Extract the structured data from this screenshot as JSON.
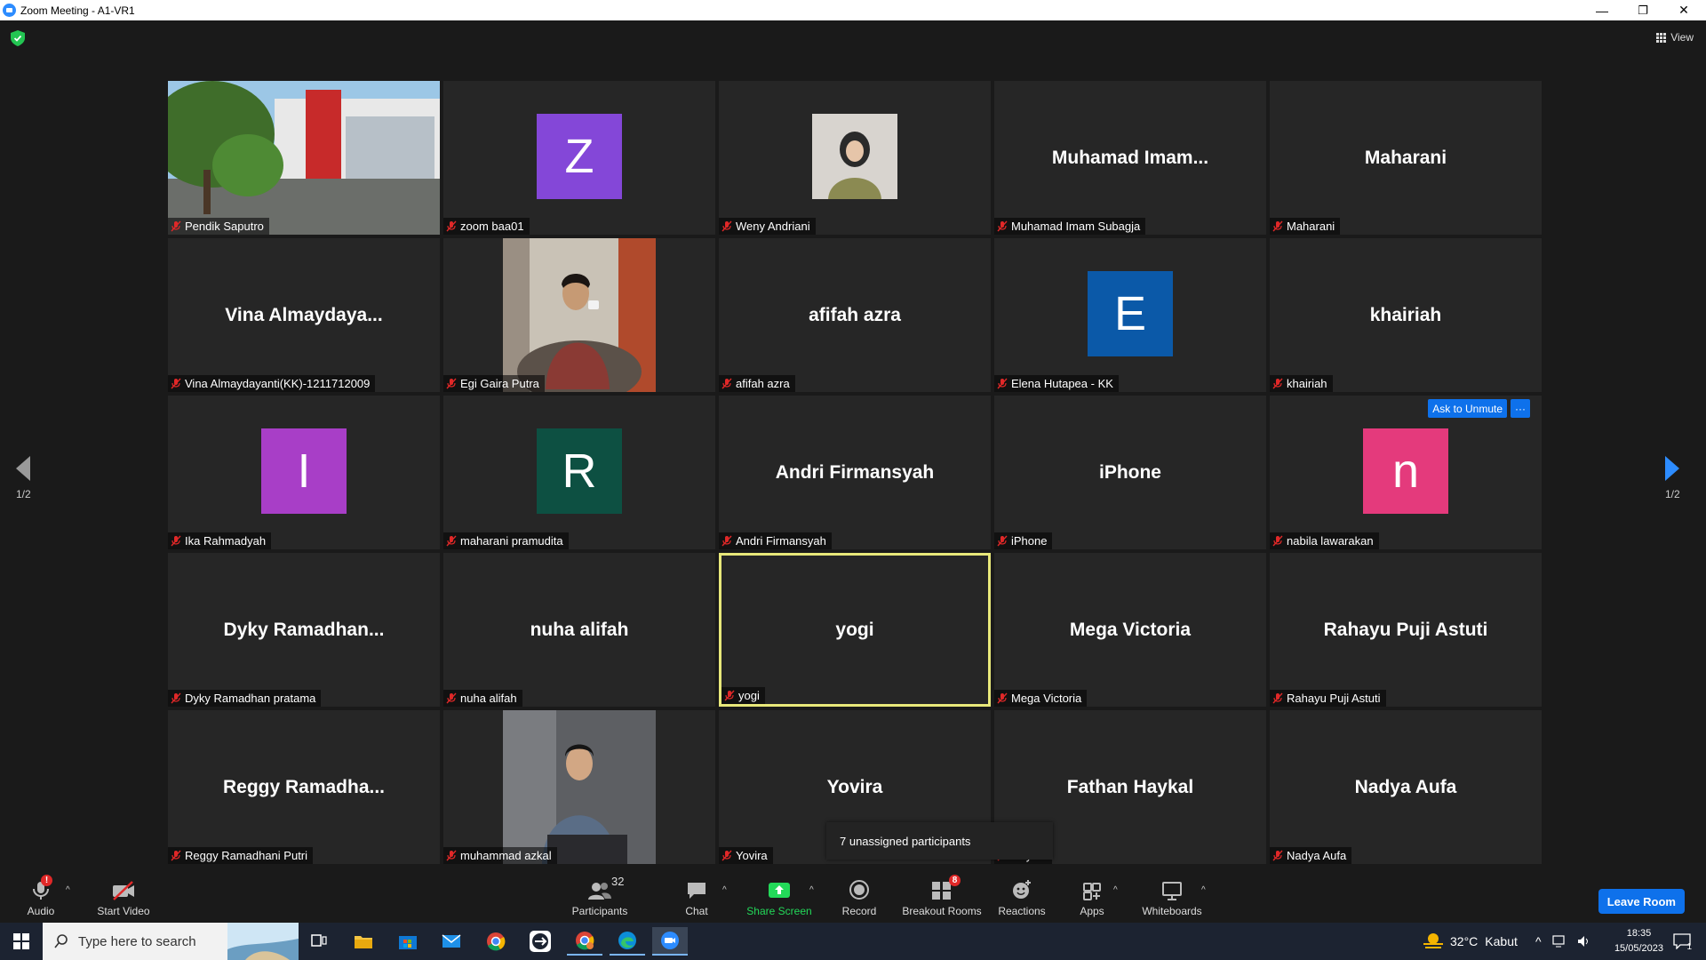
{
  "window": {
    "title": "Zoom Meeting - A1-VR1",
    "minimize": "—",
    "restore": "❐",
    "close": "✕"
  },
  "meeting": {
    "view_label": "View",
    "page_indicator_left": "1/2",
    "page_indicator_right": "1/2",
    "ask_to_unmute": "Ask to Unmute",
    "more_label": "···",
    "unassigned": "7 unassigned participants",
    "tiles": [
      {
        "bigname": "",
        "label": "Pendik Saputro",
        "kind": "photo-building"
      },
      {
        "bigname": "",
        "label": "zoom baa01",
        "kind": "avatar",
        "letter": "Z",
        "color": "#8447d8"
      },
      {
        "bigname": "",
        "label": "Weny Andriani",
        "kind": "photo-small"
      },
      {
        "bigname": "Muhamad  Imam...",
        "label": "Muhamad Imam Subagja",
        "kind": "name"
      },
      {
        "bigname": "Maharani",
        "label": "Maharani",
        "kind": "name"
      },
      {
        "bigname": "Vina  Almaydaya...",
        "label": "Vina Almaydayanti(KK)-1211712009",
        "kind": "name"
      },
      {
        "bigname": "",
        "label": "Egi Gaira Putra",
        "kind": "photo-man1"
      },
      {
        "bigname": "afifah azra",
        "label": "afifah azra",
        "kind": "name"
      },
      {
        "bigname": "",
        "label": "Elena Hutapea - KK",
        "kind": "avatar",
        "letter": "E",
        "color": "#0b59a8"
      },
      {
        "bigname": "khairiah",
        "label": "khairiah",
        "kind": "name"
      },
      {
        "bigname": "",
        "label": "Ika Rahmadyah",
        "kind": "avatar",
        "letter": "I",
        "color": "#a83ec7"
      },
      {
        "bigname": "",
        "label": "maharani pramudita",
        "kind": "avatar",
        "letter": "R",
        "color": "#0d5042"
      },
      {
        "bigname": "Andri Firmansyah",
        "label": "Andri Firmansyah",
        "kind": "name"
      },
      {
        "bigname": "iPhone",
        "label": "iPhone",
        "kind": "name"
      },
      {
        "bigname": "",
        "label": "nabila lawarakan",
        "kind": "avatar",
        "letter": "n",
        "color": "#e43a7c"
      },
      {
        "bigname": "Dyky  Ramadhan...",
        "label": "Dyky Ramadhan pratama",
        "kind": "name"
      },
      {
        "bigname": "nuha alifah",
        "label": "nuha alifah",
        "kind": "name"
      },
      {
        "bigname": "yogi",
        "label": "yogi",
        "kind": "name",
        "active": true
      },
      {
        "bigname": "Mega Victoria",
        "label": "Mega Victoria",
        "kind": "name"
      },
      {
        "bigname": "Rahayu Puji Astuti",
        "label": "Rahayu Puji Astuti",
        "kind": "name"
      },
      {
        "bigname": "Reggy  Ramadha...",
        "label": "Reggy Ramadhani Putri",
        "kind": "name"
      },
      {
        "bigname": "",
        "label": "muhammad azkal",
        "kind": "photo-man2"
      },
      {
        "bigname": "Yovira",
        "label": "Yovira",
        "kind": "name"
      },
      {
        "bigname": "Fathan Haykal",
        "label": "Haykal",
        "kind": "name"
      },
      {
        "bigname": "Nadya Aufa",
        "label": "Nadya Aufa",
        "kind": "name"
      }
    ]
  },
  "toolbar": {
    "audio": "Audio",
    "start_video": "Start Video",
    "participants": "Participants",
    "participants_count": "32",
    "chat": "Chat",
    "share_screen": "Share Screen",
    "record": "Record",
    "breakout_rooms": "Breakout Rooms",
    "breakout_badge": "8",
    "reactions": "Reactions",
    "apps": "Apps",
    "whiteboards": "Whiteboards",
    "leave": "Leave Room",
    "audio_badge": "!",
    "share_color": "#23d959"
  },
  "taskbar": {
    "search_placeholder": "Type here to search",
    "weather_temp": "32°C",
    "weather_desc": "Kabut",
    "time": "18:35",
    "date": "15/05/2023",
    "notif_count": "1"
  }
}
